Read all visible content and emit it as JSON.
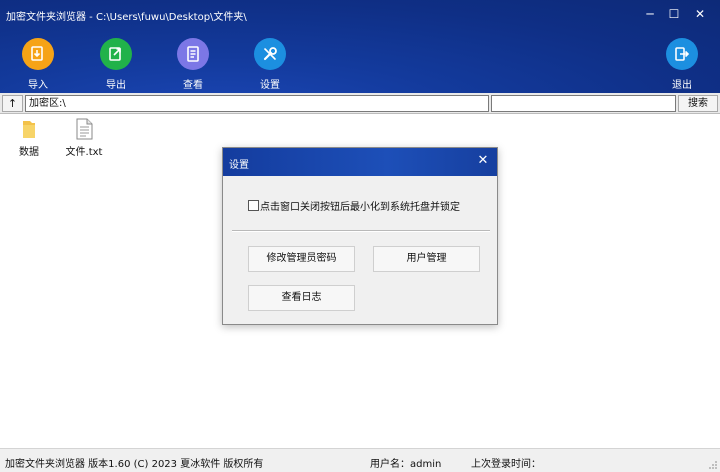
{
  "window": {
    "title": "加密文件夹浏览器 - C:\\Users\\fuwu\\Desktop\\文件夹\\",
    "min_glyph": "─",
    "max_glyph": "☐",
    "close_glyph": "✕"
  },
  "toolbar": {
    "items": [
      {
        "label": "导入",
        "icon": "import-icon",
        "color": "#f6a316"
      },
      {
        "label": "导出",
        "icon": "export-icon",
        "color": "#21b24a"
      },
      {
        "label": "查看",
        "icon": "view-icon",
        "color": "#7c77e6"
      },
      {
        "label": "设置",
        "icon": "settings-icon",
        "color": "#1c8fe0"
      },
      {
        "label": "退出",
        "icon": "exit-icon",
        "color": "#1c8fe0"
      }
    ]
  },
  "pathbar": {
    "up_label": "↑",
    "path_value": "加密区:\\",
    "search_value": "",
    "search_label": "搜索"
  },
  "files": [
    {
      "name": "数据",
      "icon": "folder-icon"
    },
    {
      "name": "文件.txt",
      "icon": "text-file-icon"
    }
  ],
  "dialog": {
    "title": "设置",
    "checkbox_label": "点击窗口关闭按钮后最小化到系统托盘并锁定",
    "checkbox_checked": false,
    "buttons": {
      "change_password": "修改管理员密码",
      "user_management": "用户管理",
      "view_log": "查看日志"
    }
  },
  "status": {
    "app_info": "加密文件夹浏览器 版本1.60 (C) 2023 夏冰软件 版权所有",
    "user_label": "用户名：admin",
    "last_login_label": "上次登录时间："
  }
}
